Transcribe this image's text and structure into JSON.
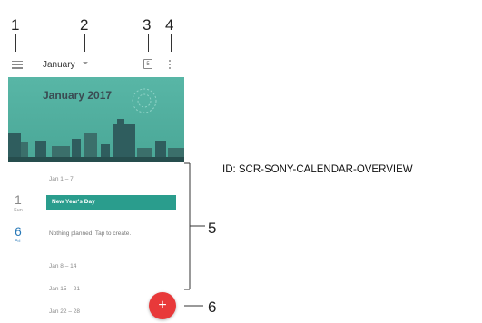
{
  "callouts": [
    "1",
    "2",
    "3",
    "4",
    "5",
    "6"
  ],
  "appbar": {
    "month": "January",
    "today_icon_label": "5",
    "icons": [
      "menu-icon",
      "dropdown-caret-icon",
      "today-icon",
      "overflow-menu-icon"
    ]
  },
  "banner": {
    "title": "January 2017",
    "color": "#58b6a6"
  },
  "agenda": {
    "weeks": [
      "Jan 1 – 7",
      "Jan 8 – 14",
      "Jan 15 – 21",
      "Jan 22 – 28"
    ],
    "days": [
      {
        "num": "1",
        "name": "Sun",
        "event": "New Year's Day"
      },
      {
        "num": "6",
        "name": "Fri",
        "event": "Nothing planned. Tap to create."
      }
    ]
  },
  "fab": {
    "label": "+",
    "color": "#e8393a"
  },
  "figure_id": "ID: SCR-SONY-CALENDAR-OVERVIEW"
}
